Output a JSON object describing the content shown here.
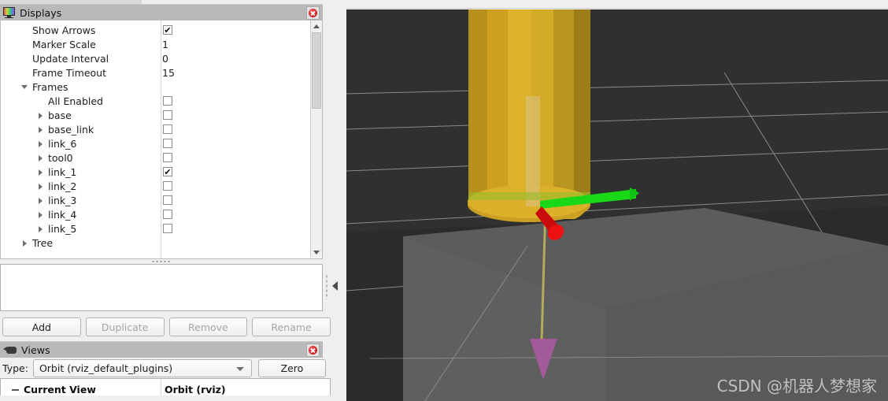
{
  "displays_panel": {
    "icon": "monitor-icon",
    "title": "Displays",
    "close_icon": "close-icon",
    "properties": [
      {
        "label": "Show Arrows",
        "indent": 0,
        "arrow": "none",
        "type": "checkbox",
        "checked": true
      },
      {
        "label": "Marker Scale",
        "indent": 0,
        "arrow": "none",
        "type": "value",
        "value": "1"
      },
      {
        "label": "Update Interval",
        "indent": 0,
        "arrow": "none",
        "type": "value",
        "value": "0"
      },
      {
        "label": "Frame Timeout",
        "indent": 0,
        "arrow": "none",
        "type": "value",
        "value": "15"
      },
      {
        "label": "Frames",
        "indent": 0,
        "arrow": "expanded",
        "type": "none",
        "value": ""
      },
      {
        "label": "All Enabled",
        "indent": 1,
        "arrow": "none",
        "type": "checkbox",
        "checked": false
      },
      {
        "label": "base",
        "indent": 1,
        "arrow": "collapsed",
        "type": "checkbox",
        "checked": false
      },
      {
        "label": "base_link",
        "indent": 1,
        "arrow": "collapsed",
        "type": "checkbox",
        "checked": false
      },
      {
        "label": "link_6",
        "indent": 1,
        "arrow": "collapsed",
        "type": "checkbox",
        "checked": false
      },
      {
        "label": "tool0",
        "indent": 1,
        "arrow": "collapsed",
        "type": "checkbox",
        "checked": false
      },
      {
        "label": "link_1",
        "indent": 1,
        "arrow": "collapsed",
        "type": "checkbox",
        "checked": true
      },
      {
        "label": "link_2",
        "indent": 1,
        "arrow": "collapsed",
        "type": "checkbox",
        "checked": false
      },
      {
        "label": "link_3",
        "indent": 1,
        "arrow": "collapsed",
        "type": "checkbox",
        "checked": false
      },
      {
        "label": "link_4",
        "indent": 1,
        "arrow": "collapsed",
        "type": "checkbox",
        "checked": false
      },
      {
        "label": "link_5",
        "indent": 1,
        "arrow": "collapsed",
        "type": "checkbox",
        "checked": false
      },
      {
        "label": "Tree",
        "indent": 0,
        "arrow": "collapsed",
        "type": "none",
        "value": ""
      }
    ],
    "checkmark_glyph": "✔",
    "scrollbar": {
      "up_icon": "scroll-up-arrow-icon",
      "down_icon": "scroll-down-arrow-icon"
    },
    "buttons": [
      {
        "label": "Add",
        "enabled": true
      },
      {
        "label": "Duplicate",
        "enabled": false
      },
      {
        "label": "Remove",
        "enabled": false
      },
      {
        "label": "Rename",
        "enabled": false
      }
    ]
  },
  "views_panel": {
    "icon": "camera-icon",
    "title": "Views",
    "close_icon": "close-icon",
    "type_label": "Type:",
    "type_value": "Orbit (rviz_default_plugins)",
    "zero_label": "Zero",
    "current_view_label": "Current View",
    "current_view_value": "Orbit (rviz)"
  },
  "viewport": {
    "watermark": "CSDN @机器人梦想家",
    "background_color": "#303030",
    "grid_color": "#a8a8a8",
    "ground_plane_color": "#5b5b5b",
    "robot_link_color": "#d9ae23",
    "axis_x_color": "#d00000",
    "axis_y_color": "#18d818",
    "axis_z_color": "#a85a9e"
  }
}
